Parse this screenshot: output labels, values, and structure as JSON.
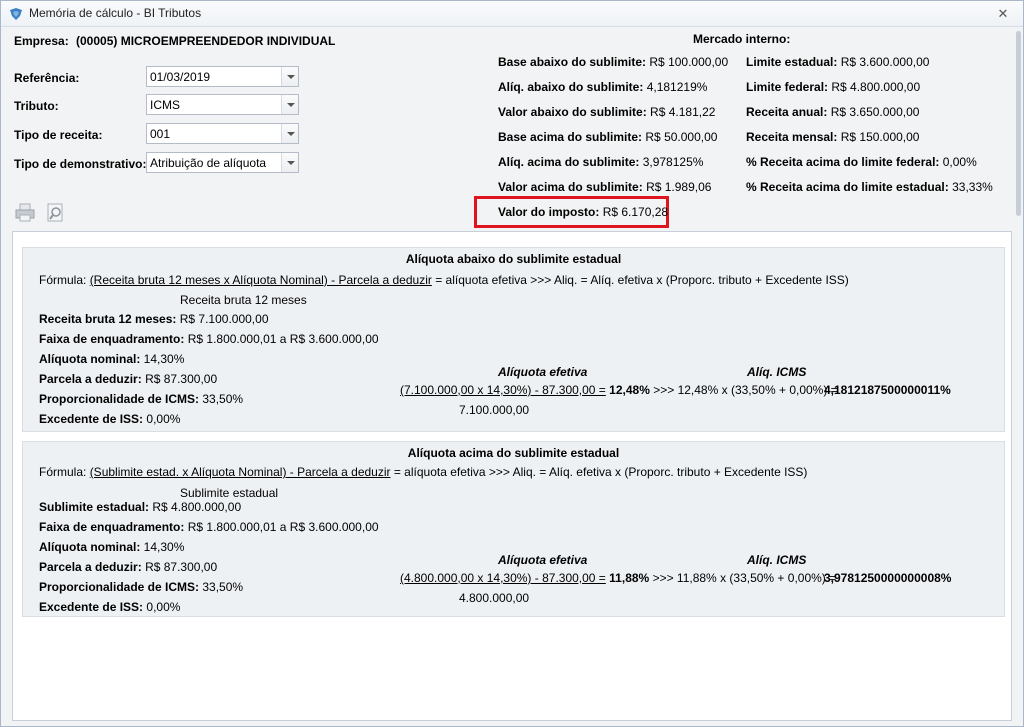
{
  "window": {
    "title": "Memória de cálculo - BI Tributos"
  },
  "header": {
    "empresa_label": "Empresa:",
    "empresa_value": "(00005) MICROEMPREENDEDOR INDIVIDUAL"
  },
  "form": {
    "referencia": {
      "label": "Referência:",
      "value": "01/03/2019"
    },
    "tributo": {
      "label": "Tributo:",
      "value": "ICMS"
    },
    "tipo_receita": {
      "label": "Tipo de receita:",
      "value": "001"
    },
    "tipo_demonstrativo": {
      "label": "Tipo de demonstrativo:",
      "value": "Atribuição de alíquota"
    }
  },
  "mercado": {
    "title": "Mercado interno:",
    "left": [
      {
        "label": "Base abaixo do sublimite:",
        "value": "R$ 100.000,00"
      },
      {
        "label": "Alíq. abaixo do sublimite:",
        "value": "4,181219%"
      },
      {
        "label": "Valor abaixo do sublimite:",
        "value": "R$ 4.181,22"
      },
      {
        "label": "Base acima do sublimite:",
        "value": "R$ 50.000,00"
      },
      {
        "label": "Alíq. acima do sublimite:",
        "value": "3,978125%"
      },
      {
        "label": "Valor acima do sublimite:",
        "value": "R$ 1.989,06"
      }
    ],
    "right": [
      {
        "label": "Limite estadual:",
        "value": "R$ 3.600.000,00"
      },
      {
        "label": "Limite federal:",
        "value": "R$ 4.800.000,00"
      },
      {
        "label": "Receita anual:",
        "value": "R$ 3.650.000,00"
      },
      {
        "label": "Receita mensal:",
        "value": "R$ 150.000,00"
      },
      {
        "label": "% Receita acima do limite federal:",
        "value": "0,00%"
      },
      {
        "label": "% Receita acima do limite estadual:",
        "value": "33,33%"
      }
    ],
    "imposto": {
      "label": "Valor do imposto:",
      "value": "R$ 6.170,28"
    }
  },
  "panel1": {
    "title": "Alíquota abaixo do sublimite estadual",
    "formula_label": "Fórmula:",
    "formula_numer": "(Receita bruta 12 meses x Alíquota Nominal) - Parcela a deduzir",
    "formula_rest": "= alíquota efetiva   >>>   Aliq. = Alíq. efetiva x (Proporc. tributo + Excedente ISS)",
    "formula_denom": "Receita bruta 12 meses",
    "rows": [
      {
        "label": "Receita bruta 12 meses:",
        "value": "R$ 7.100.000,00"
      },
      {
        "label": "Faixa de enquadramento:",
        "value": "R$ 1.800.000,01 a R$ 3.600.000,00"
      },
      {
        "label": "Alíquota nominal:",
        "value": "14,30%"
      },
      {
        "label": "Parcela a deduzir:",
        "value": "R$ 87.300,00"
      },
      {
        "label": "Proporcionalidade de ICMS:",
        "value": "33,50%"
      },
      {
        "label": "Excedente de ISS:",
        "value": "0,00%"
      }
    ],
    "aliq_efetiva_title": "Alíquota efetiva",
    "aliq_icms_title": "Alíq. ICMS",
    "calc_numer": "(7.100.000,00 x 14,30%) - 87.300,00 =",
    "calc_result": "12,48%",
    "calc_icms": ">>> 12,48% x (33,50% + 0,00%) =",
    "calc_icms_result": "4,1812187500000011%",
    "calc_denom": "7.100.000,00"
  },
  "panel2": {
    "title": "Alíquota acima do sublimite estadual",
    "formula_label": "Fórmula:",
    "formula_numer": "(Sublimite estad. x Alíquota Nominal) - Parcela a deduzir",
    "formula_rest": "= alíquota efetiva >>> Aliq. = Alíq. efetiva x (Proporc. tributo + Excedente ISS)",
    "formula_denom": "Sublimite estadual",
    "rows": [
      {
        "label": "Sublimite estadual:",
        "value": "R$ 4.800.000,00"
      },
      {
        "label": "Faixa de enquadramento:",
        "value": "R$ 1.800.000,01 a R$ 3.600.000,00"
      },
      {
        "label": "Alíquota nominal:",
        "value": "14,30%"
      },
      {
        "label": "Parcela a deduzir:",
        "value": "R$ 87.300,00"
      },
      {
        "label": "Proporcionalidade de ICMS:",
        "value": "33,50%"
      },
      {
        "label": "Excedente de ISS:",
        "value": "0,00%"
      }
    ],
    "aliq_efetiva_title": "Alíquota efetiva",
    "aliq_icms_title": "Alíq. ICMS",
    "calc_numer": "(4.800.000,00 x 14,30%) - 87.300,00 =",
    "calc_result": "11,88%",
    "calc_icms": ">>> 11,88% x (33,50% + 0,00%) =",
    "calc_icms_result": "3,9781250000000008%",
    "calc_denom": "4.800.000,00"
  }
}
